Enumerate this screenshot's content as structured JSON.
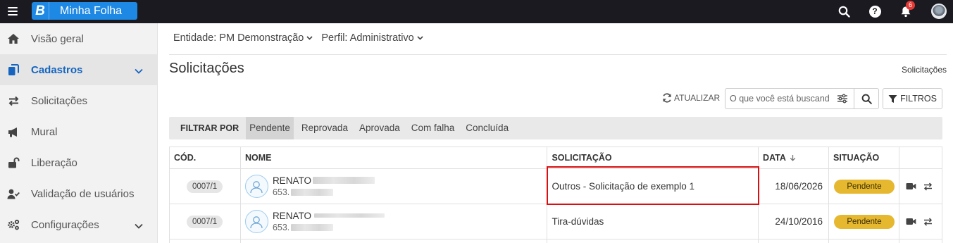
{
  "topbar": {
    "brand_logo": "B",
    "brand_name": "Minha Folha",
    "notifications_count": "6",
    "help_glyph": "?",
    "colors": {
      "bar": "#1b1a21",
      "brand": "#1e88e5",
      "badge": "#e53935"
    }
  },
  "sidebar": {
    "items": [
      {
        "label": "Visão geral",
        "icon": "home-icon"
      },
      {
        "label": "Cadastros",
        "icon": "copy-icon",
        "active": true,
        "expandable": true
      },
      {
        "label": "Solicitações",
        "icon": "exchange-icon"
      },
      {
        "label": "Mural",
        "icon": "megaphone-icon"
      },
      {
        "label": "Liberação",
        "icon": "unlock-icon"
      },
      {
        "label": "Validação de usuários",
        "icon": "user-check-icon"
      },
      {
        "label": "Configurações",
        "icon": "cogs-icon",
        "expandable": true
      }
    ]
  },
  "context": {
    "entity": "Entidade: PM Demonstração",
    "profile": "Perfil: Administrativo"
  },
  "page": {
    "title": "Solicitações",
    "breadcrumb": "Solicitações"
  },
  "toolbar": {
    "refresh_label": "ATUALIZAR",
    "search_placeholder": "O que você está buscand",
    "filters_label": "FILTROS"
  },
  "filter_bar": {
    "label": "FILTRAR POR",
    "tabs": [
      "Pendente",
      "Reprovada",
      "Aprovada",
      "Com falha",
      "Concluída"
    ],
    "selected": "Pendente"
  },
  "table": {
    "columns": [
      "CÓD.",
      "NOME",
      "SOLICITAÇÃO",
      "DATA",
      "SITUAÇÃO"
    ],
    "sort_column": "DATA",
    "sort_direction": "desc",
    "rows": [
      {
        "code": "0007/1",
        "name": "RENATO",
        "doc": "653.",
        "request": "Outros - Solicitação de exemplo 1",
        "date": "18/06/2026",
        "status": "Pendente",
        "highlighted": true
      },
      {
        "code": "0007/1",
        "name": "RENATO",
        "doc": "653.",
        "request": "Tira-dúvidas",
        "date": "24/10/2016",
        "status": "Pendente"
      }
    ],
    "status_color": "#e6b830",
    "highlight_color": "#d81010"
  }
}
